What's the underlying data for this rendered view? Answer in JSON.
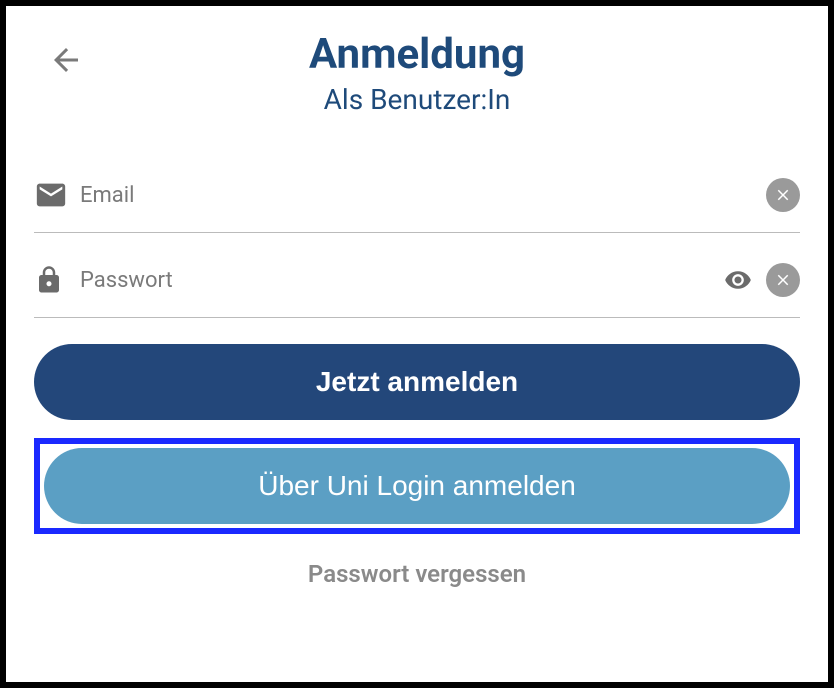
{
  "header": {
    "title": "Anmeldung",
    "subtitle": "Als Benutzer:In"
  },
  "fields": {
    "email": {
      "label": "Email"
    },
    "password": {
      "label": "Passwort"
    }
  },
  "buttons": {
    "login": "Jetzt anmelden",
    "uni_login": "Über Uni Login anmelden",
    "forgot": "Passwort vergessen"
  }
}
